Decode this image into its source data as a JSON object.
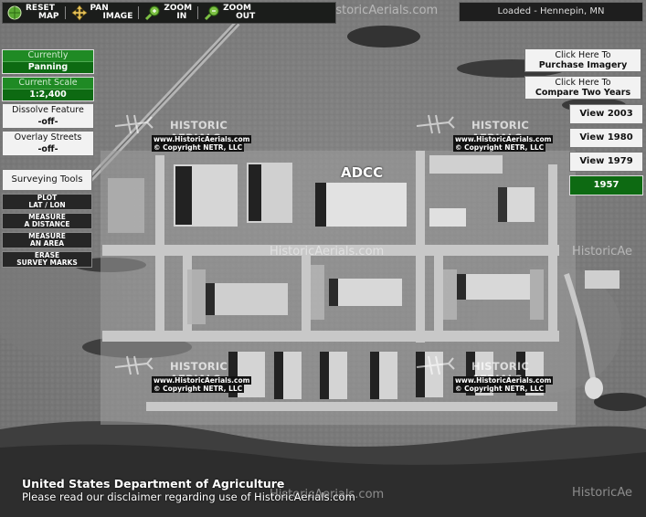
{
  "toolbar": {
    "reset": {
      "line1": "RESET",
      "line2": "MAP"
    },
    "pan": {
      "line1": "PAN",
      "line2": "IMAGE"
    },
    "zoom_in": {
      "line1": "ZOOM",
      "line2": "IN"
    },
    "zoom_out": {
      "line1": "ZOOM",
      "line2": "OUT"
    }
  },
  "status": "Loaded - Hennepin, MN",
  "left_panel": {
    "currently": {
      "label": "Currently",
      "value": "Panning"
    },
    "scale": {
      "label": "Current Scale",
      "value": "1:2,400"
    },
    "dissolve": {
      "label": "Dissolve Feature",
      "value": "-off-"
    },
    "overlay": {
      "label": "Overlay Streets",
      "value": "-off-"
    },
    "surveying_title": "Surveying Tools",
    "tools": [
      {
        "line1": "PLOT",
        "line2": "LAT / LON"
      },
      {
        "line1": "MEASURE",
        "line2": "A DISTANCE"
      },
      {
        "line1": "MEASURE",
        "line2": "AN AREA"
      },
      {
        "line1": "ERASE",
        "line2": "SURVEY MARKS"
      }
    ]
  },
  "right_panel": {
    "purchase": {
      "line1": "Click Here To",
      "line2": "Purchase Imagery"
    },
    "compare": {
      "line1": "Click Here To",
      "line2": "Compare Two Years"
    },
    "years": [
      "View 2003",
      "View 1980",
      "View 1979",
      "1957"
    ]
  },
  "map_label": "ADCC",
  "watermarks": {
    "site": "HistoricAerials.com",
    "site_cut": "HistoricAe",
    "badge_title": "HISTORIC AERIALS",
    "badge_url": "www.HistoricAerials.com",
    "badge_copy": "© Copyright NETR, LLC"
  },
  "footer": {
    "agency": "United States Department of Agriculture",
    "disclaimer": "Please read our disclaimer regarding use of HistoricAerials.com"
  },
  "colors": {
    "accent_green": "#1f8a24",
    "dark_green": "#0d6a12"
  }
}
